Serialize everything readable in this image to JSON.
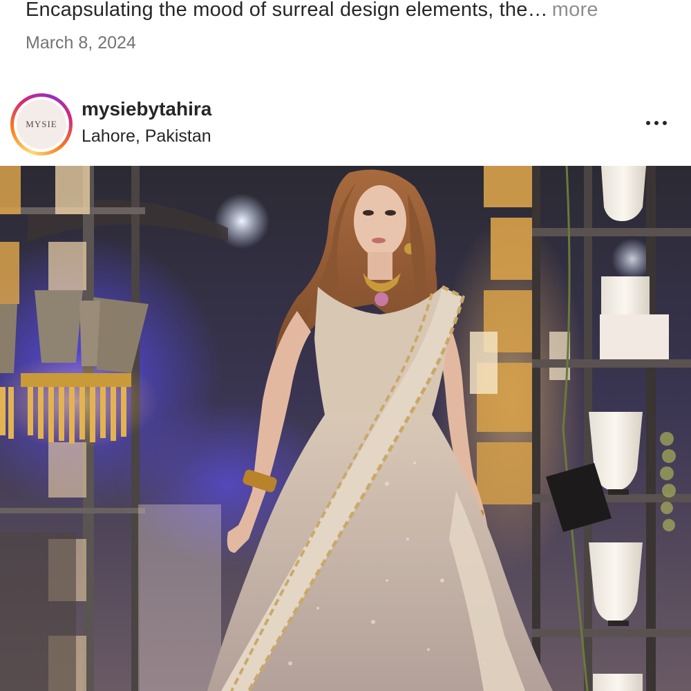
{
  "caption": {
    "text": "Encapsulating the mood of surreal design elements, the…",
    "more_label": "more"
  },
  "date": "March 8, 2024",
  "post": {
    "username": "mysiebytahira",
    "location": "Lahore, Pakistan",
    "avatar_text": "MYSIE",
    "more_options_icon": "three-dots-horizontal-icon"
  },
  "image": {
    "subject": "model in embellished beige saree gown on runway with chandeliers and lanterns"
  },
  "colors": {
    "text": "#262626",
    "muted": "#737373",
    "more": "#8e8e8e",
    "ring_gradient": [
      "#feda75",
      "#fa7e1e",
      "#d62976",
      "#962fbf"
    ]
  }
}
